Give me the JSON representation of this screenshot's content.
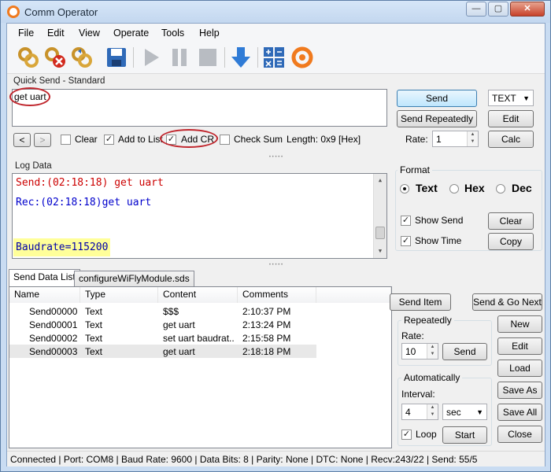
{
  "window": {
    "title": "Comm Operator",
    "minimize": "—",
    "maximize": "▢",
    "close": "✕"
  },
  "menu": [
    "File",
    "Edit",
    "View",
    "Operate",
    "Tools",
    "Help"
  ],
  "toolbar": [
    "open-icon",
    "disconnect-icon",
    "connect-settings-icon",
    "save-icon",
    "play-icon",
    "pause-icon",
    "stop-icon",
    "download-icon",
    "calculator-icon",
    "app-logo-icon"
  ],
  "quick_send": {
    "title": "Quick Send - Standard",
    "text": "get uart",
    "send": "Send",
    "send_repeatedly": "Send Repeatedly",
    "format": "TEXT",
    "edit": "Edit",
    "calc": "Calc",
    "rate_label": "Rate:",
    "rate_value": "1",
    "prev": "<",
    "next": ">",
    "clear": "Clear",
    "add_to_list": "Add to List",
    "add_cr": "Add CR",
    "check_sum": "Check Sum",
    "length": "Length: 0x9 [Hex]",
    "checks": {
      "clear": false,
      "add_to_list": true,
      "add_cr": true,
      "check_sum": false
    }
  },
  "log": {
    "title": "Log Data",
    "lines": [
      {
        "text": "Send:(02:18:18) get uart",
        "color": "#cc0000"
      },
      {
        "text": "Rec:(02:18:18)get uart",
        "color": "#0000cc"
      },
      {
        "text": "Baudrate=115200",
        "color": "#0000aa",
        "highlight": "#ffff99"
      }
    ]
  },
  "format": {
    "title": "Format",
    "options": [
      "Text",
      "Hex",
      "Dec"
    ],
    "selected": "Text",
    "show_send": "Show Send",
    "show_time": "Show Time",
    "clear": "Clear",
    "copy": "Copy"
  },
  "tabs": [
    "Send Data List",
    "configureWiFlyModule.sds"
  ],
  "list": {
    "columns": [
      "Name",
      "Type",
      "Content",
      "Comments"
    ],
    "rows": [
      {
        "name": "Send00000",
        "type": "Text",
        "content": "$$$",
        "comments": "2:10:37 PM"
      },
      {
        "name": "Send00001",
        "type": "Text",
        "content": "get uart",
        "comments": "2:13:24 PM"
      },
      {
        "name": "Send00002",
        "type": "Text",
        "content": "set uart baudrat...",
        "comments": "2:15:58 PM"
      },
      {
        "name": "Send00003",
        "type": "Text",
        "content": "get uart",
        "comments": "2:18:18 PM"
      }
    ]
  },
  "list_actions": {
    "send_item": "Send Item",
    "send_go_next": "Send & Go Next",
    "repeatedly": "Repeatedly",
    "rate_label": "Rate:",
    "rate_value": "10",
    "send": "Send",
    "automatically": "Automatically",
    "interval_label": "Interval:",
    "interval_value": "4",
    "interval_unit": "sec",
    "loop": "Loop",
    "start": "Start",
    "new": "New",
    "edit": "Edit",
    "load": "Load",
    "save_as": "Save As",
    "save_all": "Save All",
    "close": "Close"
  },
  "status": "Connected | Port: COM8 | Baud Rate: 9600 | Data Bits: 8 | Parity: None | DTC: None | Recv:243/22 | Send: 55/5"
}
